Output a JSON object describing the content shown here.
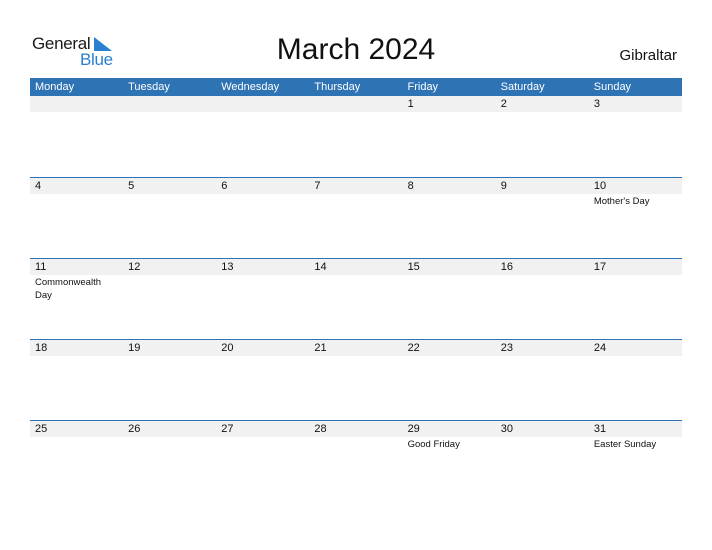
{
  "logo": {
    "line1": "General",
    "line2": "Blue"
  },
  "title": "March 2024",
  "country": "Gibraltar",
  "weekdays": [
    "Monday",
    "Tuesday",
    "Wednesday",
    "Thursday",
    "Friday",
    "Saturday",
    "Sunday"
  ],
  "weeks": [
    {
      "days": [
        {
          "num": "",
          "holiday": ""
        },
        {
          "num": "",
          "holiday": ""
        },
        {
          "num": "",
          "holiday": ""
        },
        {
          "num": "",
          "holiday": ""
        },
        {
          "num": "1",
          "holiday": ""
        },
        {
          "num": "2",
          "holiday": ""
        },
        {
          "num": "3",
          "holiday": ""
        }
      ]
    },
    {
      "days": [
        {
          "num": "4",
          "holiday": ""
        },
        {
          "num": "5",
          "holiday": ""
        },
        {
          "num": "6",
          "holiday": ""
        },
        {
          "num": "7",
          "holiday": ""
        },
        {
          "num": "8",
          "holiday": ""
        },
        {
          "num": "9",
          "holiday": ""
        },
        {
          "num": "10",
          "holiday": "Mother's Day"
        }
      ]
    },
    {
      "days": [
        {
          "num": "11",
          "holiday": "Commonwealth Day"
        },
        {
          "num": "12",
          "holiday": ""
        },
        {
          "num": "13",
          "holiday": ""
        },
        {
          "num": "14",
          "holiday": ""
        },
        {
          "num": "15",
          "holiday": ""
        },
        {
          "num": "16",
          "holiday": ""
        },
        {
          "num": "17",
          "holiday": ""
        }
      ]
    },
    {
      "days": [
        {
          "num": "18",
          "holiday": ""
        },
        {
          "num": "19",
          "holiday": ""
        },
        {
          "num": "20",
          "holiday": ""
        },
        {
          "num": "21",
          "holiday": ""
        },
        {
          "num": "22",
          "holiday": ""
        },
        {
          "num": "23",
          "holiday": ""
        },
        {
          "num": "24",
          "holiday": ""
        }
      ]
    },
    {
      "days": [
        {
          "num": "25",
          "holiday": ""
        },
        {
          "num": "26",
          "holiday": ""
        },
        {
          "num": "27",
          "holiday": ""
        },
        {
          "num": "28",
          "holiday": ""
        },
        {
          "num": "29",
          "holiday": "Good Friday"
        },
        {
          "num": "30",
          "holiday": ""
        },
        {
          "num": "31",
          "holiday": "Easter Sunday"
        }
      ]
    }
  ],
  "colors": {
    "header_bg": "#2e73b4",
    "strip_bg": "#f1f1f1",
    "brand_blue": "#2a7fd0"
  }
}
